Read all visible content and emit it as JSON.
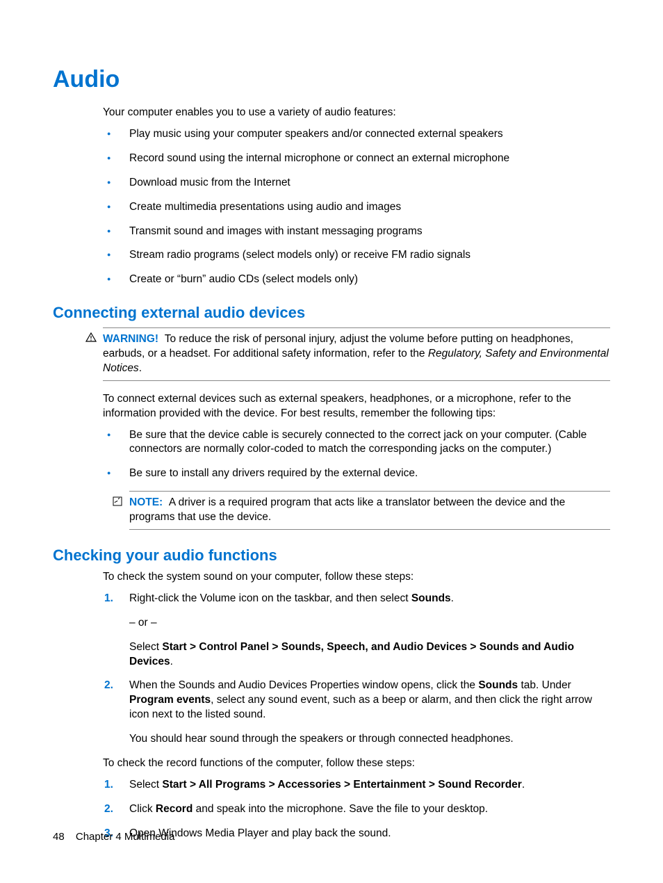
{
  "heading": "Audio",
  "intro": "Your computer enables you to use a variety of audio features:",
  "features": [
    "Play music using your computer speakers and/or connected external speakers",
    "Record sound using the internal microphone or connect an external microphone",
    "Download music from the Internet",
    "Create multimedia presentations using audio and images",
    "Transmit sound and images with instant messaging programs",
    "Stream radio programs (select models only) or receive FM radio signals",
    "Create or “burn” audio CDs (select models only)"
  ],
  "section1": {
    "title": "Connecting external audio devices",
    "warning_label": "WARNING!",
    "warning_text_a": "To reduce the risk of personal injury, adjust the volume before putting on headphones, earbuds, or a headset. For additional safety information, refer to the ",
    "warning_text_italic": "Regulatory, Safety and Environmental Notices",
    "warning_text_b": ".",
    "para": "To connect external devices such as external speakers, headphones, or a microphone, refer to the information provided with the device. For best results, remember the following tips:",
    "tips": [
      "Be sure that the device cable is securely connected to the correct jack on your computer. (Cable connectors are normally color-coded to match the corresponding jacks on the computer.)",
      "Be sure to install any drivers required by the external device."
    ],
    "note_label": "NOTE:",
    "note_text": "A driver is a required program that acts like a translator between the device and the programs that use the device."
  },
  "section2": {
    "title": "Checking your audio functions",
    "intro": "To check the system sound on your computer, follow these steps:",
    "step1_a": "Right-click the Volume icon on the taskbar, and then select ",
    "step1_bold": "Sounds",
    "step1_b": ".",
    "step1_or": "– or –",
    "step1_c": "Select ",
    "step1_path": "Start > Control Panel > Sounds, Speech, and Audio Devices > Sounds and Audio Devices",
    "step1_d": ".",
    "step2_a": "When the Sounds and Audio Devices Properties window opens, click the ",
    "step2_bold1": "Sounds",
    "step2_b": " tab. Under ",
    "step2_bold2": "Program events",
    "step2_c": ", select any sound event, such as a beep or alarm, and then click the right arrow icon next to the listed sound.",
    "step2_after": "You should hear sound through the speakers or through connected headphones.",
    "rec_intro": "To check the record functions of the computer, follow these steps:",
    "rec1_a": "Select ",
    "rec1_bold": "Start > All Programs > Accessories > Entertainment > Sound Recorder",
    "rec1_b": ".",
    "rec2_a": "Click ",
    "rec2_bold": "Record",
    "rec2_b": " and speak into the microphone. Save the file to your desktop.",
    "rec3": "Open Windows Media Player and play back the sound."
  },
  "footer": {
    "page": "48",
    "chapter": "Chapter 4   Multimedia"
  }
}
